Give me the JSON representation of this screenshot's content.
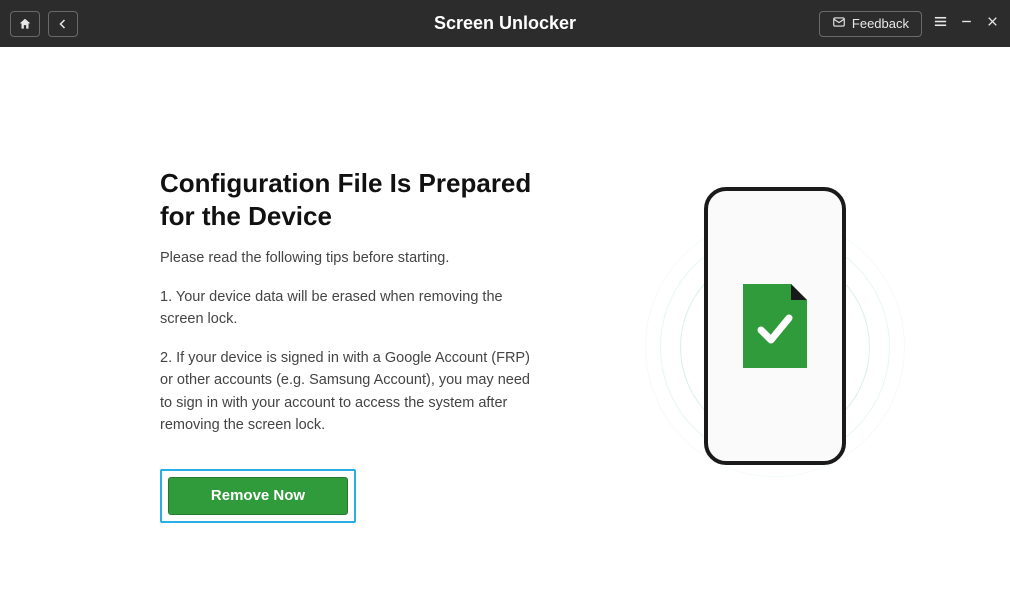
{
  "titlebar": {
    "title": "Screen Unlocker",
    "feedback_label": "Feedback"
  },
  "main": {
    "heading": "Configuration File Is Prepared for the Device",
    "subtext": "Please read the following tips before starting.",
    "tip1": "1. Your device data will be erased when removing the screen lock.",
    "tip2": "2. If your device is signed in with a Google Account (FRP) or other accounts (e.g. Samsung Account), you may need to sign in with your account to access the system after removing the screen lock.",
    "remove_label": "Remove Now"
  },
  "colors": {
    "accent_green": "#2f9b3a",
    "highlight_blue": "#2aaee6",
    "titlebar_bg": "#2c2c2c"
  }
}
